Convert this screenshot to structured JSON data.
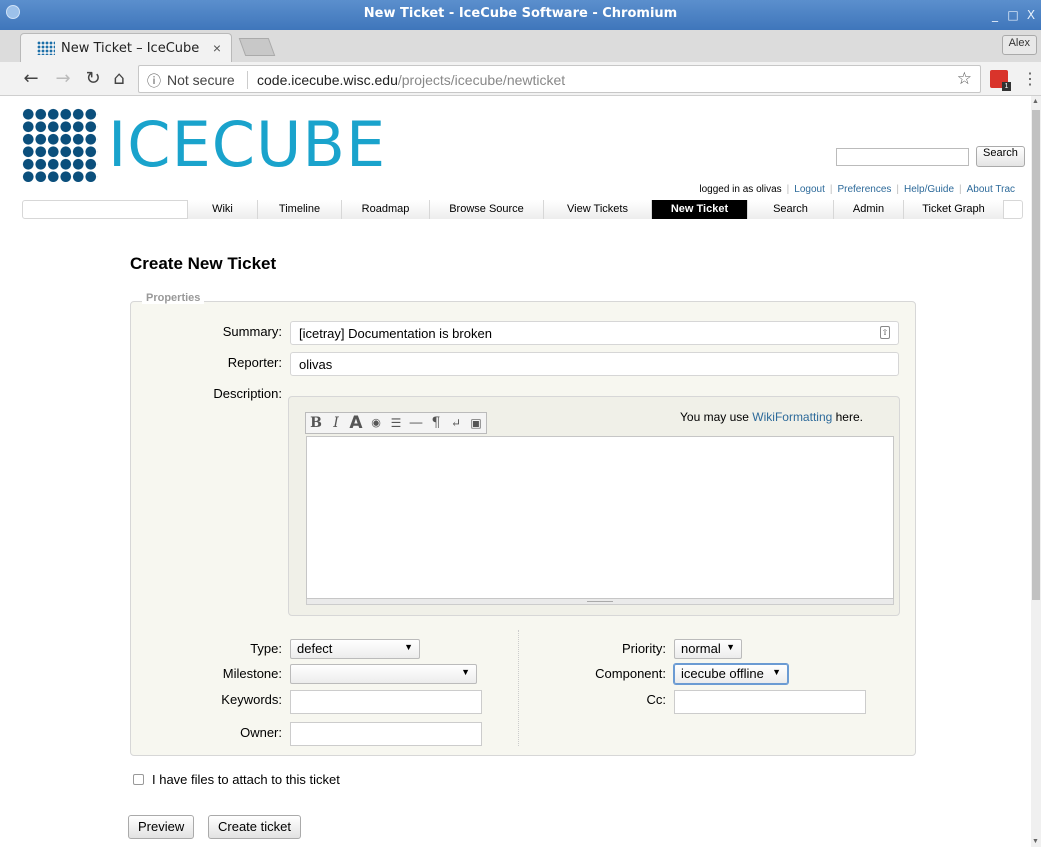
{
  "window": {
    "title": "New Ticket - IceCube Software - Chromium"
  },
  "browser": {
    "tab_title": "New Ticket – IceCube Sc",
    "tab_close": "×",
    "profile": "Alex",
    "security_label": "Not secure",
    "url_host": "code.icecube.wisc.edu",
    "url_path": "/projects/icecube/newticket",
    "extension_badge": "1"
  },
  "header": {
    "logo_text": "ICECUBE",
    "search_button": "Search",
    "search_value": ""
  },
  "metanav": {
    "logged_in": "logged in as olivas",
    "items": [
      "Logout",
      "Preferences",
      "Help/Guide",
      "About Trac"
    ]
  },
  "mainnav": {
    "items": [
      "Wiki",
      "Timeline",
      "Roadmap",
      "Browse Source",
      "View Tickets",
      "New Ticket",
      "Search",
      "Admin",
      "Ticket Graph"
    ],
    "active": "New Ticket"
  },
  "form": {
    "title": "Create New Ticket",
    "legend": "Properties",
    "summary_label": "Summary:",
    "summary_value": "[icetray] Documentation is broken",
    "reporter_label": "Reporter:",
    "reporter_value": "olivas",
    "description_label": "Description:",
    "wiki_hint_prefix": "You may use ",
    "wiki_hint_link": "WikiFormatting",
    "wiki_hint_suffix": " here.",
    "toolbar_icons": [
      "bold-icon",
      "italic-icon",
      "heading-icon",
      "link-icon",
      "code-icon",
      "hr-icon",
      "paragraph-icon",
      "linebreak-icon",
      "image-icon"
    ],
    "type_label": "Type:",
    "type_value": "defect",
    "milestone_label": "Milestone:",
    "milestone_value": "",
    "keywords_label": "Keywords:",
    "owner_label": "Owner:",
    "priority_label": "Priority:",
    "priority_value": "normal",
    "component_label": "Component:",
    "component_value": "icecube offline",
    "cc_label": "Cc:",
    "attach_label": "I have files to attach to this ticket",
    "preview_button": "Preview",
    "create_button": "Create ticket"
  },
  "colors": {
    "titlebar": "#4a82c4",
    "logo_dots": "#0b4f7c",
    "logo_text": "#1aa3cc",
    "link": "#2d6a9a",
    "active_nav": "#000000"
  }
}
